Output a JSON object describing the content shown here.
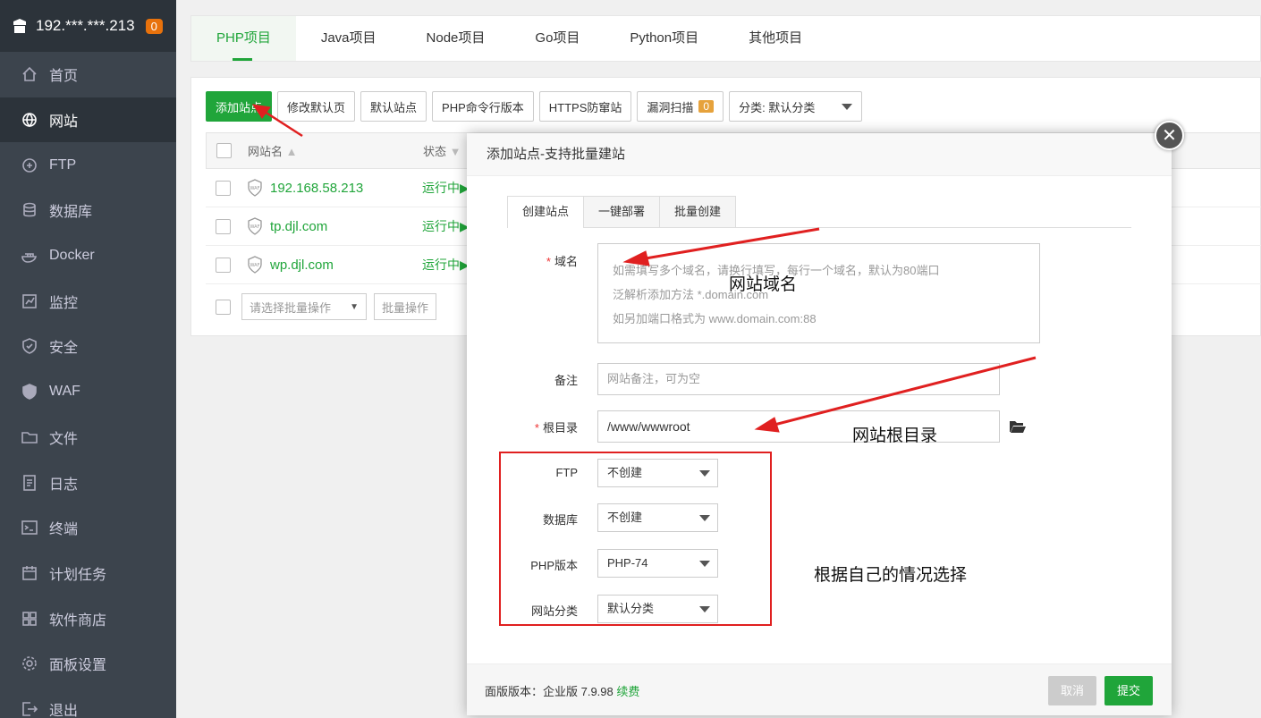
{
  "sidebar": {
    "server": "192.***.***.213",
    "badge": "0",
    "items": [
      {
        "label": "首页",
        "icon": "home-icon"
      },
      {
        "label": "网站",
        "icon": "globe-icon",
        "active": true
      },
      {
        "label": "FTP",
        "icon": "ftp-icon"
      },
      {
        "label": "数据库",
        "icon": "database-icon"
      },
      {
        "label": "Docker",
        "icon": "docker-icon"
      },
      {
        "label": "监控",
        "icon": "monitor-icon"
      },
      {
        "label": "安全",
        "icon": "shield-icon"
      },
      {
        "label": "WAF",
        "icon": "waf-icon"
      },
      {
        "label": "文件",
        "icon": "folder-icon"
      },
      {
        "label": "日志",
        "icon": "log-icon"
      },
      {
        "label": "终端",
        "icon": "terminal-icon"
      },
      {
        "label": "计划任务",
        "icon": "calendar-icon"
      },
      {
        "label": "软件商店",
        "icon": "grid-icon"
      },
      {
        "label": "面板设置",
        "icon": "gear-icon"
      },
      {
        "label": "退出",
        "icon": "logout-icon"
      }
    ]
  },
  "project_tabs": [
    "PHP项目",
    "Java项目",
    "Node项目",
    "Go项目",
    "Python项目",
    "其他项目"
  ],
  "toolbar": {
    "add_site": "添加站点",
    "modify_default": "修改默认页",
    "default_site": "默认站点",
    "php_cli": "PHP命令行版本",
    "https_guard": "HTTPS防窜站",
    "vuln_scan": "漏洞扫描",
    "vuln_count": "0",
    "category": "分类: 默认分类"
  },
  "table": {
    "col_name": "网站名",
    "col_status": "状态",
    "rows": [
      {
        "name": "192.168.58.213",
        "status": "运行中▶"
      },
      {
        "name": "tp.djl.com",
        "status": "运行中▶"
      },
      {
        "name": "wp.djl.com",
        "status": "运行中▶"
      }
    ],
    "batch_placeholder": "请选择批量操作",
    "batch_button": "批量操作"
  },
  "modal": {
    "title": "添加站点-支持批量建站",
    "tabs": [
      "创建站点",
      "一键部署",
      "批量创建"
    ],
    "domain_label": "域名",
    "domain_placeholder": [
      "如需填写多个域名，请换行填写，每行一个域名，默认为80端口",
      "泛解析添加方法 *.domain.com",
      "如另加端口格式为 www.domain.com:88"
    ],
    "remark_label": "备注",
    "remark_placeholder": "网站备注，可为空",
    "root_label": "根目录",
    "root_value": "/www/wwwroot",
    "ftp_label": "FTP",
    "ftp_value": "不创建",
    "db_label": "数据库",
    "db_value": "不创建",
    "php_label": "PHP版本",
    "php_value": "PHP-74",
    "category_label": "网站分类",
    "category_value": "默认分类",
    "version_text": "面版版本：企业版 7.9.98",
    "renew": "续费",
    "cancel": "取消",
    "submit": "提交"
  },
  "annotations": {
    "domain_note": "网站域名",
    "root_note": "网站根目录",
    "choose_note": "根据自己的情况选择"
  },
  "colors": {
    "accent": "#20a53a",
    "sidebar": "#3c444d",
    "annotation": "#e02020"
  }
}
